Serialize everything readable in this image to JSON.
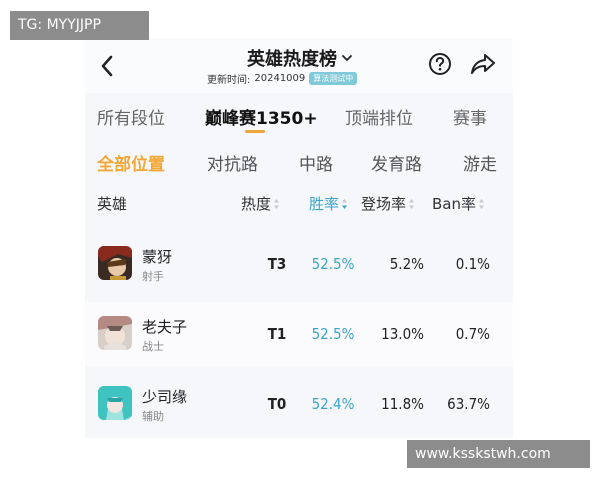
{
  "watermarks": {
    "top_left": "TG: MYYJJPP",
    "bottom_right": "www.ksskstwh.com"
  },
  "header": {
    "title": "英雄热度榜",
    "update_label": "更新时间:",
    "update_date": "20241009",
    "badge": "算法测试中",
    "icons": {
      "back": "back-arrow-icon",
      "dropdown": "chevron-down-icon",
      "help": "question-icon",
      "share": "share-icon"
    }
  },
  "rank_tabs": [
    {
      "label": "所有段位",
      "active": false
    },
    {
      "label": "巅峰赛1350+",
      "active": true
    },
    {
      "label": "顶端排位",
      "active": false
    },
    {
      "label": "赛事",
      "active": false
    }
  ],
  "position_tabs": [
    {
      "label": "全部位置",
      "active": true
    },
    {
      "label": "对抗路",
      "active": false
    },
    {
      "label": "中路",
      "active": false
    },
    {
      "label": "发育路",
      "active": false
    },
    {
      "label": "游走",
      "active": false
    }
  ],
  "columns": {
    "hero": "英雄",
    "heat": "热度",
    "win_rate": "胜率",
    "pick_rate": "登场率",
    "ban_rate": "Ban率"
  },
  "rows": [
    {
      "name": "蒙犽",
      "role": "射手",
      "tier": "T3",
      "win_rate": "52.5%",
      "pick_rate": "5.2%",
      "ban_rate": "0.1%"
    },
    {
      "name": "老夫子",
      "role": "战士",
      "tier": "T1",
      "win_rate": "52.5%",
      "pick_rate": "13.0%",
      "ban_rate": "0.7%"
    },
    {
      "name": "少司缘",
      "role": "辅助",
      "tier": "T0",
      "win_rate": "52.4%",
      "pick_rate": "11.8%",
      "ban_rate": "63.7%"
    }
  ],
  "colors": {
    "accent_orange": "#f3a737",
    "accent_blue": "#3aa5c9",
    "badge": "#7fc9d8"
  }
}
